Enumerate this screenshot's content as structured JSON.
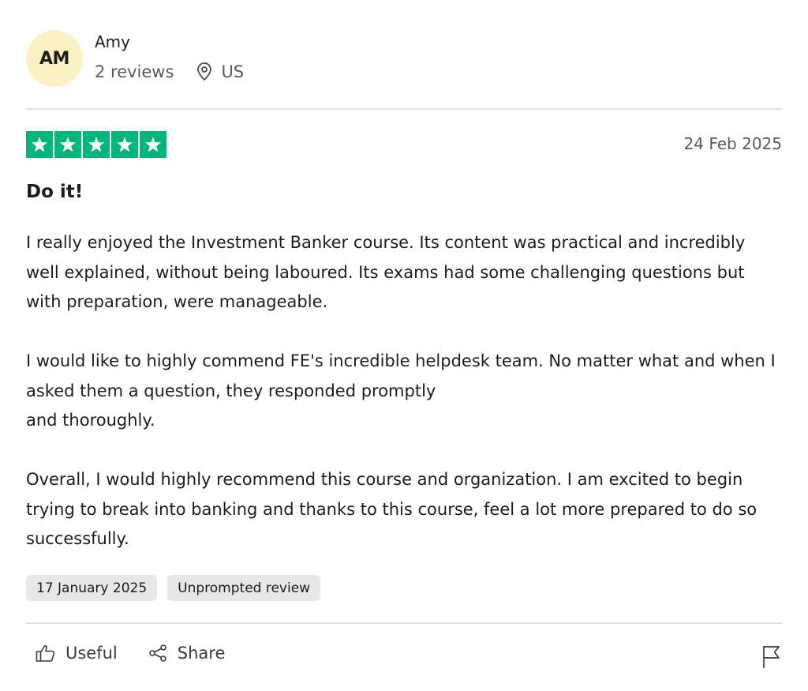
{
  "reviewer": {
    "initials": "AM",
    "name": "Amy",
    "review_count": "2 reviews",
    "country": "US",
    "avatar_color": "#fcf1c2"
  },
  "rating": {
    "stars": 5,
    "max_stars": 5,
    "star_color": "#00b67a"
  },
  "review": {
    "date": "24 Feb 2025",
    "title": "Do it!",
    "paragraphs": [
      "I really enjoyed the Investment Banker course. Its content was practical and incredibly well explained, without being laboured. Its exams had some challenging questions but with preparation, were manageable.",
      "I would like to highly commend FE's incredible helpdesk team. No matter what and when I asked them a question, they responded promptly\nand thoroughly.",
      "Overall, I would highly recommend this course and organization. I am excited to begin trying to break into banking and thanks to this course, feel a lot more prepared to do so successfully."
    ]
  },
  "tags": {
    "experience_date": "17 January 2025",
    "review_type": "Unprompted review"
  },
  "actions": {
    "useful_label": "Useful",
    "share_label": "Share",
    "icons": [
      "thumbs-up-icon",
      "share-icon",
      "flag-icon"
    ]
  }
}
